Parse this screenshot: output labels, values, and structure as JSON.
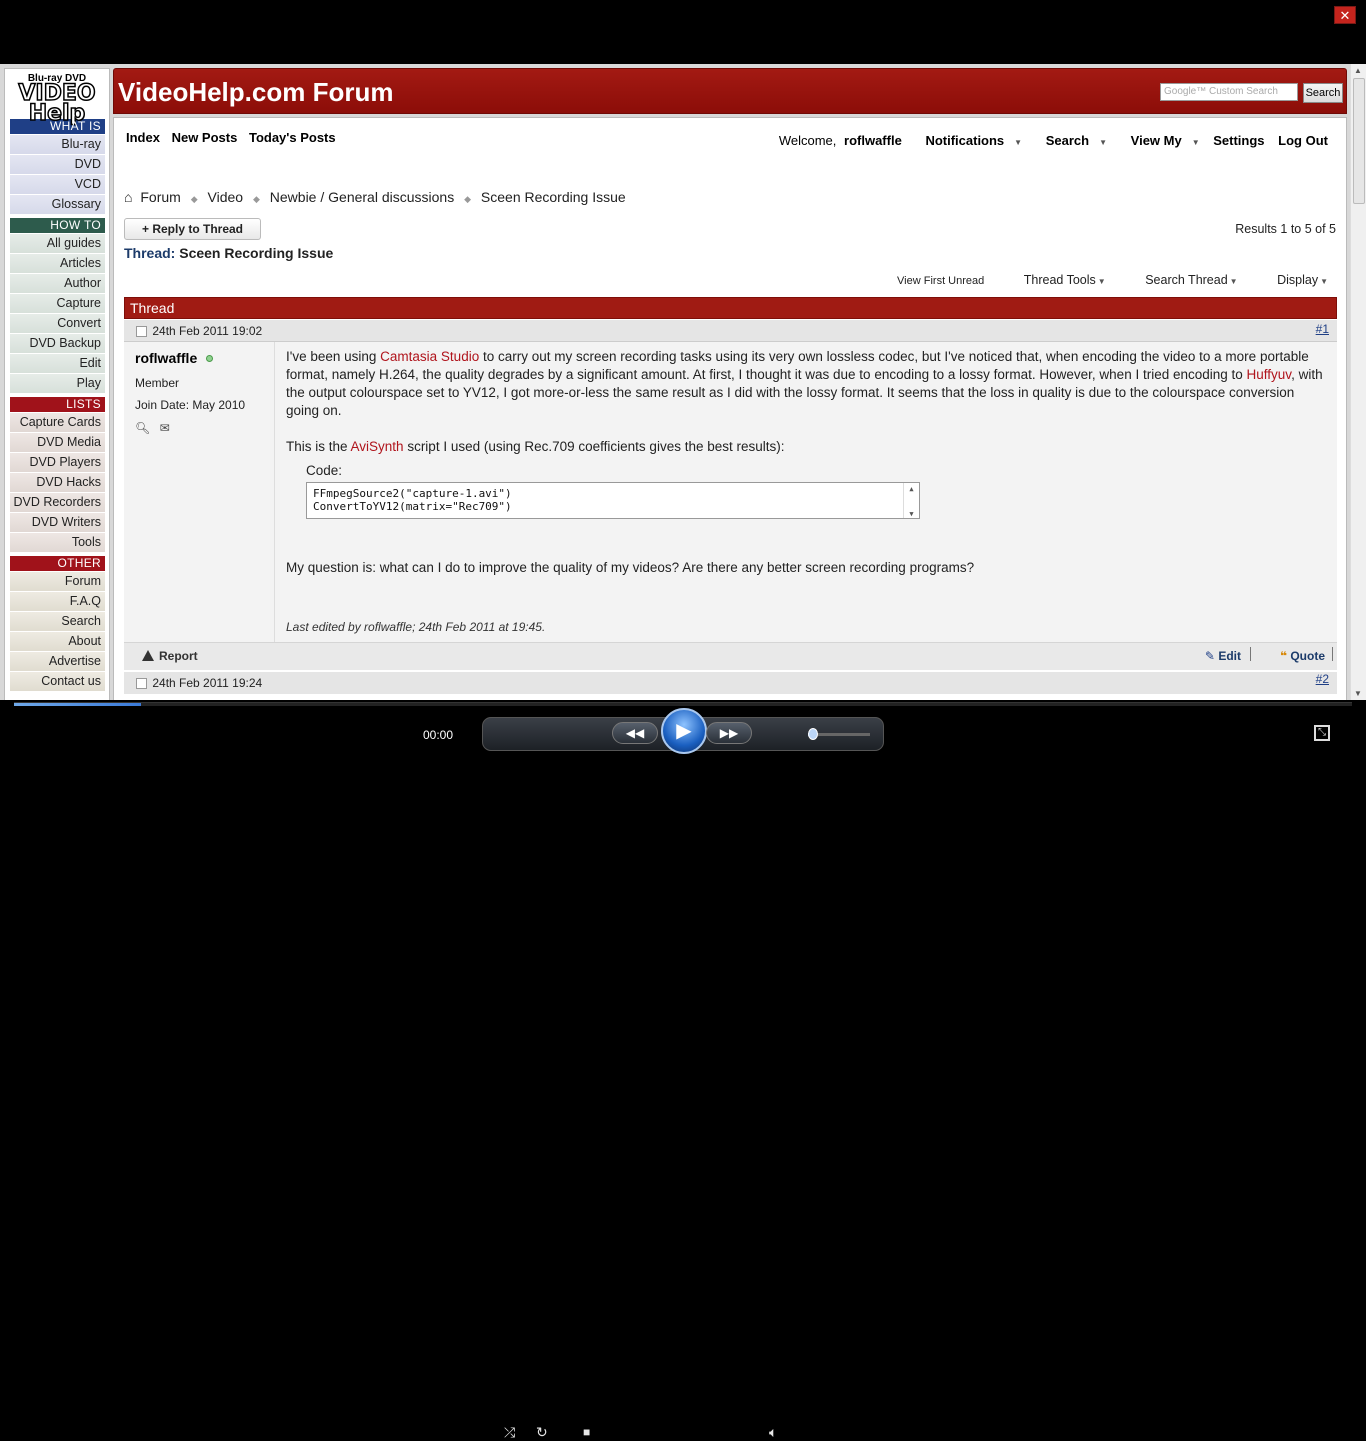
{
  "window": {
    "close_label": "✕"
  },
  "sidebar": {
    "logo_top": "Blu-ray DVD",
    "logo_main": "VIDEO Help",
    "sections": [
      {
        "title": "WHAT IS",
        "items": [
          "Blu-ray",
          "DVD",
          "VCD",
          "Glossary"
        ]
      },
      {
        "title": "HOW TO",
        "items": [
          "All guides",
          "Articles",
          "Author",
          "Capture",
          "Convert",
          "DVD Backup",
          "Edit",
          "Play"
        ]
      },
      {
        "title": "LISTS",
        "items": [
          "Capture Cards",
          "DVD Media",
          "DVD Players",
          "DVD Hacks",
          "DVD Recorders",
          "DVD Writers",
          "Tools"
        ]
      },
      {
        "title": "OTHER",
        "items": [
          "Forum",
          "F.A.Q",
          "Search",
          "About",
          "Advertise",
          "Contact us"
        ]
      }
    ]
  },
  "header": {
    "title": "VideoHelp.com Forum",
    "search_placeholder": "Google™ Custom Search",
    "search_button": "Search"
  },
  "toplinks": {
    "index": "Index",
    "new_posts": "New Posts",
    "todays_posts": "Today's Posts"
  },
  "userlinks": {
    "welcome": "Welcome,",
    "username": "roflwaffle",
    "notifications": "Notifications",
    "search": "Search",
    "view_my": "View My",
    "settings": "Settings",
    "logout": "Log Out"
  },
  "breadcrumb": {
    "forum": "Forum",
    "video": "Video",
    "newbie": "Newbie / General discussions",
    "current": "Sceen Recording Issue"
  },
  "thread": {
    "reply_button": "+ Reply to Thread",
    "results": "Results 1 to 5 of 5",
    "label": "Thread:",
    "title": "Sceen Recording Issue",
    "tools": {
      "view_first_unread": "View First Unread",
      "thread_tools": "Thread Tools",
      "search_thread": "Search Thread",
      "display": "Display"
    },
    "bar_label": "Thread"
  },
  "post1": {
    "date": "24th Feb 2011 19:02",
    "number": "#1",
    "author": "roflwaffle",
    "role": "Member",
    "join_date": "Join Date: May 2010",
    "p1_a": "I've been using ",
    "p1_link1": "Camtasia Studio",
    "p1_b": " to carry out my screen recording tasks using its very own lossless codec, but I've noticed that, when encoding the video to a more portable format, namely H.264, the quality degrades by a significant amount. At first, I thought it was due to encoding to a lossy format. However, when I tried encoding to ",
    "p1_link2": "Huffyuv",
    "p1_c": ", with the output colourspace set to YV12, I got more-or-less the same result as I did with the lossy format. It seems that the loss in quality is due to the colourspace conversion going on.",
    "p2_a": "This is the ",
    "p2_link": "AviSynth",
    "p2_b": " script I used (using Rec.709 coefficients gives the best results):",
    "code_label": "Code:",
    "code_line1": "FFmpegSource2(\"capture-1.avi\")",
    "code_line2": "ConvertToYV12(matrix=\"Rec709\")",
    "question": "My question is: what can I do to improve the quality of my videos? Are there any better screen recording programs?",
    "last_edited": "Last edited by roflwaffle; 24th Feb 2011 at 19:45.",
    "report": "Report",
    "edit": "Edit",
    "quote": "Quote"
  },
  "post2": {
    "date": "24th Feb 2011 19:24",
    "number": "#2"
  },
  "player": {
    "time": "00:00"
  },
  "colors": {
    "banner": "#a31a13",
    "link": "#b0141c",
    "nav_blue": "#1f3f86"
  }
}
